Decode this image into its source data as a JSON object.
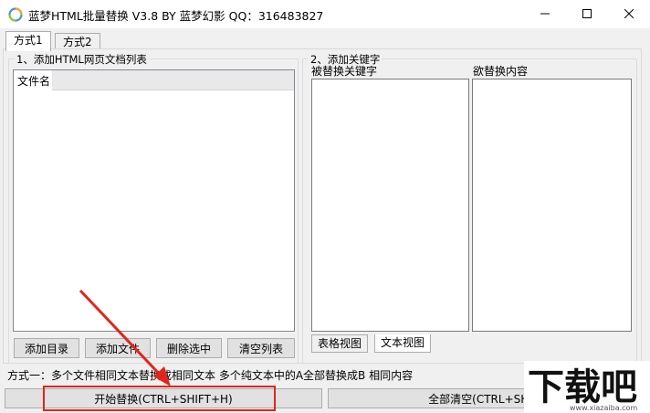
{
  "window": {
    "title": "蓝梦HTML批量替换 V3.8 BY 蓝梦幻影 QQ：316483827",
    "controls": {
      "minimize": "minimize-icon",
      "maximize": "maximize-icon",
      "close": "close-icon"
    }
  },
  "tabs": [
    {
      "label": "方式1",
      "active": true
    },
    {
      "label": "方式2",
      "active": false
    }
  ],
  "left_group": {
    "title": "1、添加HTML网页文档列表",
    "list_header": "文件名",
    "buttons": {
      "add_dir": "添加目录",
      "add_file": "添加文件",
      "delete_selected": "删除选中",
      "clear_list": "清空列表"
    }
  },
  "right_group": {
    "title": "2、添加关键字",
    "col_find": "被替换关键字",
    "col_replace": "欲替换内容",
    "view_tabs": [
      {
        "label": "表格视图",
        "active": false
      },
      {
        "label": "文本视图",
        "active": true
      }
    ]
  },
  "status_text": "方式一：多个文件相同文本替换成相同文本  多个纯文本中的A全部替换成B 相同内容",
  "bottom": {
    "start_button": "开始替换(CTRL+SHIFT+H)",
    "clear_all_button": "全部清空(CTRL+SHIFT"
  },
  "watermark": {
    "brand": "下载吧",
    "url": "www.xiazaiba.com"
  },
  "colors": {
    "annotation_red": "#e0261b",
    "face": "#f0f0f0",
    "button": "#e1e1e1"
  }
}
